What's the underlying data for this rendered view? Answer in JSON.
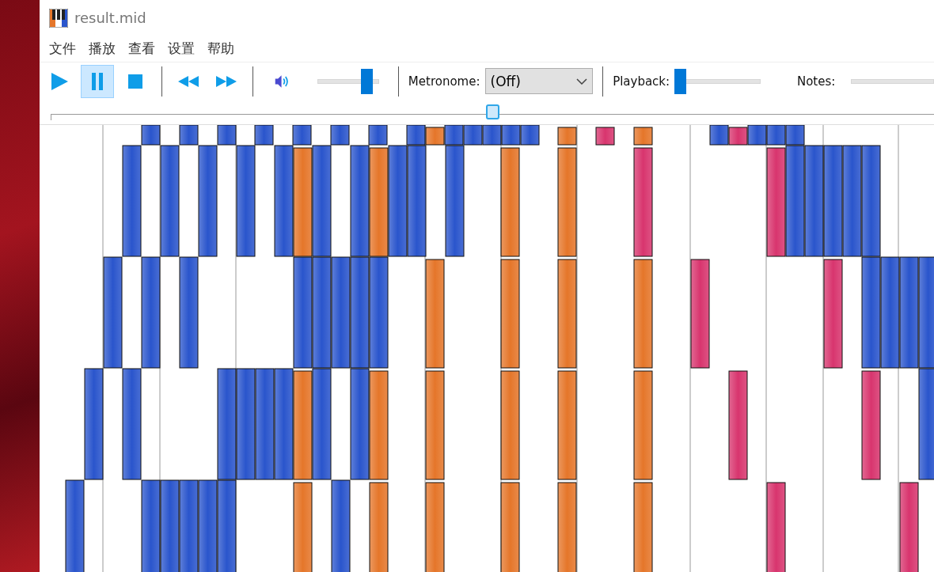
{
  "window": {
    "title": "result.mid"
  },
  "menu": [
    {
      "label": "文件"
    },
    {
      "label": "播放"
    },
    {
      "label": "查看"
    },
    {
      "label": "设置"
    },
    {
      "label": "帮助"
    }
  ],
  "transport": [
    {
      "kind": "play",
      "selected": false
    },
    {
      "kind": "pause",
      "selected": true
    },
    {
      "kind": "stop",
      "selected": false
    },
    {
      "kind": "rewind",
      "selected": false
    },
    {
      "kind": "forward",
      "selected": false
    }
  ],
  "volume": {
    "level": 0.88
  },
  "metronome": {
    "label": "Metronome:",
    "value": "(Off)"
  },
  "playback": {
    "label": "Playback:",
    "level": 0.0
  },
  "notes": {
    "label": "Notes:"
  },
  "position": {
    "level": 0.5
  }
}
